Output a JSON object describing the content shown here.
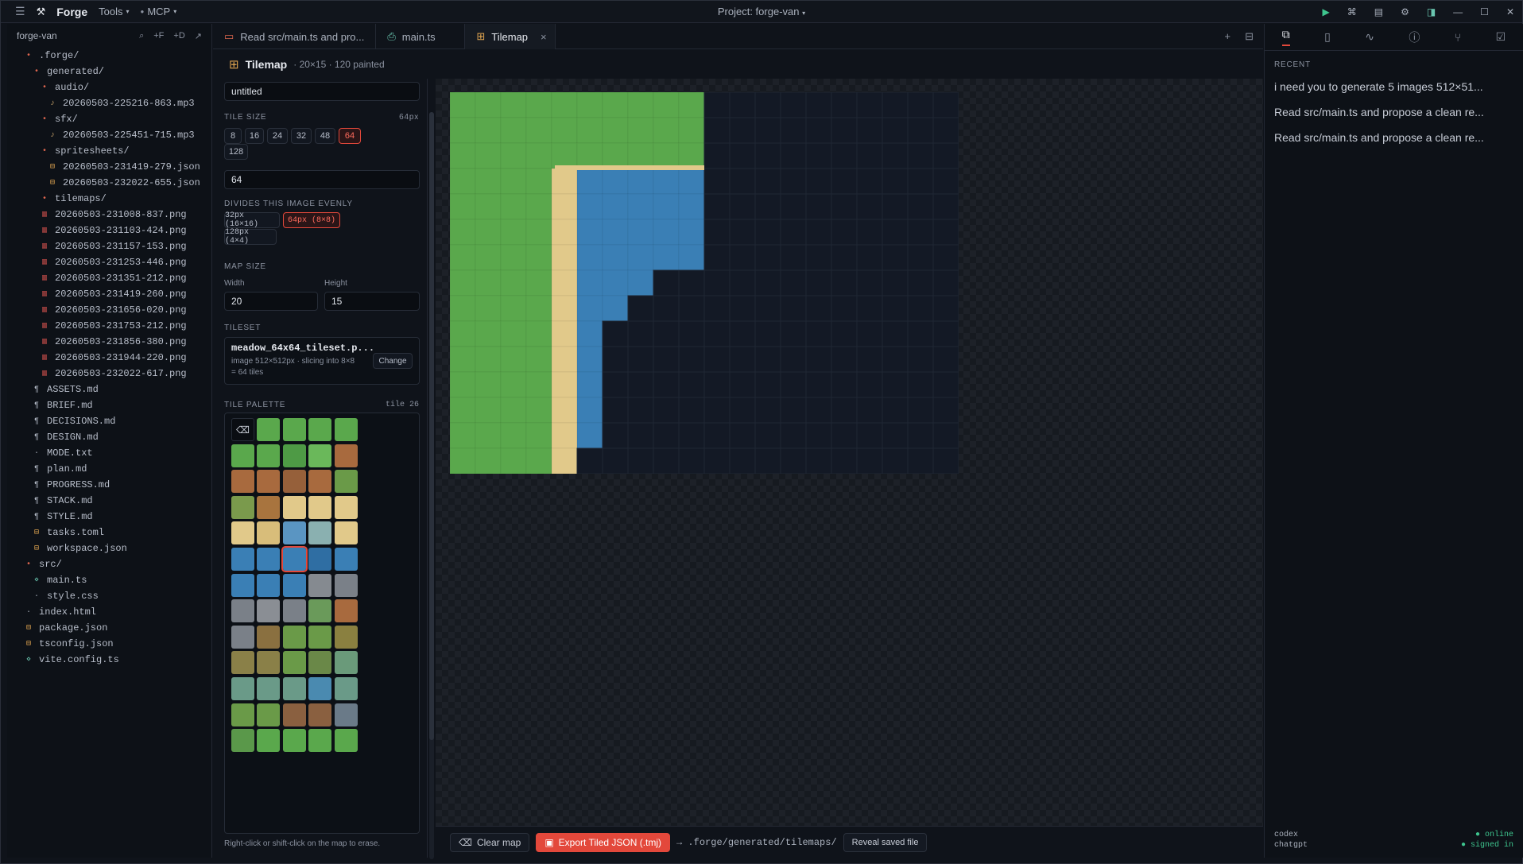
{
  "titlebar": {
    "app": "Forge",
    "menu_tools": "Tools",
    "menu_mcp": "MCP",
    "project": "Project: forge-van"
  },
  "explorer": {
    "root": "forge-van",
    "actions": [
      "⌕",
      "+F",
      "+D",
      "↗"
    ],
    "items": [
      {
        "label": ".forge/",
        "depth": 1,
        "icon": "folder-dot"
      },
      {
        "label": "generated/",
        "depth": 2,
        "icon": "folder-dot"
      },
      {
        "label": "audio/",
        "depth": 3,
        "icon": "folder-dot"
      },
      {
        "label": "20260503-225216-863.mp3",
        "depth": 4,
        "icon": "audio"
      },
      {
        "label": "sfx/",
        "depth": 3,
        "icon": "folder-dot"
      },
      {
        "label": "20260503-225451-715.mp3",
        "depth": 4,
        "icon": "audio"
      },
      {
        "label": "spritesheets/",
        "depth": 3,
        "icon": "folder-dot"
      },
      {
        "label": "20260503-231419-279.json",
        "depth": 4,
        "icon": "json"
      },
      {
        "label": "20260503-232022-655.json",
        "depth": 4,
        "icon": "json"
      },
      {
        "label": "tilemaps/",
        "depth": 3,
        "icon": "folder-dot"
      },
      {
        "label": "20260503-231008-837.png",
        "depth": 3,
        "icon": "png"
      },
      {
        "label": "20260503-231103-424.png",
        "depth": 3,
        "icon": "png"
      },
      {
        "label": "20260503-231157-153.png",
        "depth": 3,
        "icon": "png"
      },
      {
        "label": "20260503-231253-446.png",
        "depth": 3,
        "icon": "png"
      },
      {
        "label": "20260503-231351-212.png",
        "depth": 3,
        "icon": "png"
      },
      {
        "label": "20260503-231419-260.png",
        "depth": 3,
        "icon": "png"
      },
      {
        "label": "20260503-231656-020.png",
        "depth": 3,
        "icon": "png"
      },
      {
        "label": "20260503-231753-212.png",
        "depth": 3,
        "icon": "png"
      },
      {
        "label": "20260503-231856-380.png",
        "depth": 3,
        "icon": "png"
      },
      {
        "label": "20260503-231944-220.png",
        "depth": 3,
        "icon": "png"
      },
      {
        "label": "20260503-232022-617.png",
        "depth": 3,
        "icon": "png"
      },
      {
        "label": "ASSETS.md",
        "depth": 2,
        "icon": "md"
      },
      {
        "label": "BRIEF.md",
        "depth": 2,
        "icon": "md"
      },
      {
        "label": "DECISIONS.md",
        "depth": 2,
        "icon": "md"
      },
      {
        "label": "DESIGN.md",
        "depth": 2,
        "icon": "md"
      },
      {
        "label": "MODE.txt",
        "depth": 2,
        "icon": "txt"
      },
      {
        "label": "plan.md",
        "depth": 2,
        "icon": "md"
      },
      {
        "label": "PROGRESS.md",
        "depth": 2,
        "icon": "md"
      },
      {
        "label": "STACK.md",
        "depth": 2,
        "icon": "md"
      },
      {
        "label": "STYLE.md",
        "depth": 2,
        "icon": "md"
      },
      {
        "label": "tasks.toml",
        "depth": 2,
        "icon": "json"
      },
      {
        "label": "workspace.json",
        "depth": 2,
        "icon": "json"
      },
      {
        "label": "src/",
        "depth": 1,
        "icon": "folder-dot"
      },
      {
        "label": "main.ts",
        "depth": 2,
        "icon": "ts"
      },
      {
        "label": "style.css",
        "depth": 2,
        "icon": "txt"
      },
      {
        "label": "index.html",
        "depth": 1,
        "icon": "txt"
      },
      {
        "label": "package.json",
        "depth": 1,
        "icon": "json"
      },
      {
        "label": "tsconfig.json",
        "depth": 1,
        "icon": "json"
      },
      {
        "label": "vite.config.ts",
        "depth": 1,
        "icon": "ts"
      }
    ]
  },
  "tabs": [
    {
      "label": "Read src/main.ts and pro...",
      "icon": "chat-icon"
    },
    {
      "label": "main.ts",
      "icon": "file-icon"
    },
    {
      "label": "Tilemap",
      "icon": "grid-icon",
      "close": "×"
    }
  ],
  "tilemap": {
    "title": "Tilemap",
    "subtitle": "· 20×15 · 120 painted"
  },
  "panel": {
    "name_value": "untitled",
    "tile_size_label": "TILE SIZE",
    "tile_size_px": "64px",
    "tile_sizes": [
      "8",
      "16",
      "24",
      "32",
      "48",
      "64",
      "128"
    ],
    "tile_size_selected": "64",
    "tile_size_input": "64",
    "divides_label": "DIVIDES THIS IMAGE EVENLY",
    "divides": [
      "32px (16×16)",
      "64px (8×8)",
      "128px (4×4)"
    ],
    "divides_selected": "64px (8×8)",
    "map_size_label": "MAP SIZE",
    "width_label": "Width",
    "height_label": "Height",
    "width_value": "20",
    "height_value": "15",
    "tileset_label": "TILESET",
    "tileset_name": "meadow_64x64_tileset.p...",
    "tileset_info_1": "image 512×512px · slicing into 8×8",
    "tileset_info_2": "= 64 tiles",
    "change_label": "Change",
    "palette_label": "TILE PALETTE",
    "palette_tile": "tile 26",
    "hint": "Right-click or shift-click on the map to erase."
  },
  "bottom": {
    "clear_label": "Clear map",
    "export_label": "Export Tiled JSON (.tmj)",
    "path": "→ .forge/generated/tilemaps/",
    "reveal_label": "Reveal saved file"
  },
  "right": {
    "recent_label": "RECENT",
    "recent": [
      "i need you to generate 5 images 512×51...",
      "Read src/main.ts and propose a clean re...",
      "Read src/main.ts and propose a clean re..."
    ],
    "footer_name": "codex",
    "footer_status": "● online",
    "footer_name2": "chatgpt",
    "footer_status2": "● signed in"
  },
  "colors": {
    "accent": "#e3483b",
    "grass": "#5aa84c",
    "water": "#3a7fb5",
    "sand": "#e1c98a",
    "empty": "#131925"
  },
  "map_data": {
    "cols": 20,
    "rows": 15,
    "row_spans": [
      "GGGGGGGGGGEEEEEEEEEE",
      "GGGGGGGGGGEEEEEEEEEE",
      "GGGGGGGGGGEEEEEEEEEE",
      "GGGGSWWWWWEEEEEEEEEE",
      "GGGGSWWWWWEEEEEEEEEE",
      "GGGGSWWWWWEEEEEEEEEE",
      "GGGGSWWWWWEEEEEEEEEE",
      "GGGGSWWWEEEEEEEEEEEE",
      "GGGGSWWEEEEEEEEEEEEE",
      "GGGGSWEEEEEEEEEEEEEE",
      "GGGGSWEEEEEEEEEEEEEE",
      "GGGGSWEEEEEEEEEEEEEE",
      "GGGGSWEEEEEEEEEEEEEE",
      "GGGGSWEEEEEEEEEEEEEE",
      "GGGGSEEEEEEEEEEEEEEE"
    ]
  }
}
